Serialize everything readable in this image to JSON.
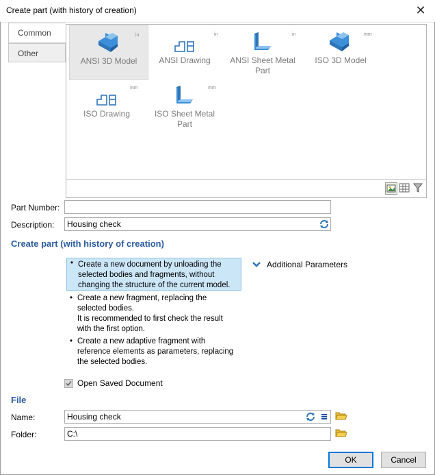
{
  "window": {
    "title": "Create part (with history of creation)",
    "close_glyph": "✕"
  },
  "tabs": [
    {
      "label": "Common",
      "active": true
    },
    {
      "label": "Other",
      "active": false
    }
  ],
  "templates": [
    {
      "label": "ANSI 3D Model",
      "unit": "in",
      "icon": "3d-model-icon",
      "selected": true
    },
    {
      "label": "ANSI Drawing",
      "unit": "in",
      "icon": "drawing-icon",
      "selected": false
    },
    {
      "label": "ANSI Sheet Metal Part",
      "unit": "in",
      "icon": "sheet-metal-icon",
      "selected": false
    },
    {
      "label": "ISO 3D Model",
      "unit": "mm",
      "icon": "3d-model-icon",
      "selected": false
    },
    {
      "label": "ISO Drawing",
      "unit": "mm",
      "icon": "drawing-icon",
      "selected": false
    },
    {
      "label": "ISO Sheet Metal Part",
      "unit": "mm",
      "icon": "sheet-metal-icon",
      "selected": false
    }
  ],
  "view_buttons": [
    "large-icons-view-icon",
    "grid-view-icon",
    "filter-icon"
  ],
  "fields": {
    "part_number_label": "Part Number:",
    "part_number_value": "",
    "description_label": "Description:",
    "description_value": "Housing check"
  },
  "section_create": "Create part (with history of creation)",
  "options": [
    {
      "text": "Create a new document by unloading the\nselected bodies and fragments, without\nchanging the structure of the current model.",
      "selected": true
    },
    {
      "text": "Create a new fragment, replacing the\nselected bodies.\nIt is recommended to first check the result\nwith the first option.",
      "selected": false
    },
    {
      "text": "Create a new adaptive fragment with\nreference elements as parameters, replacing\nthe selected bodies.",
      "selected": false
    }
  ],
  "additional_parameters": "Additional Parameters",
  "open_saved": {
    "label": "Open Saved Document",
    "checked": true
  },
  "section_file": "File",
  "file": {
    "name_label": "Name:",
    "name_value": "Housing check",
    "folder_label": "Folder:",
    "folder_value": "C:\\"
  },
  "buttons": {
    "ok": "OK",
    "cancel": "Cancel"
  },
  "colors": {
    "accent": "#2b5a9e",
    "icon_blue": "#3d8fd9",
    "selection": "#cbe6f7"
  }
}
